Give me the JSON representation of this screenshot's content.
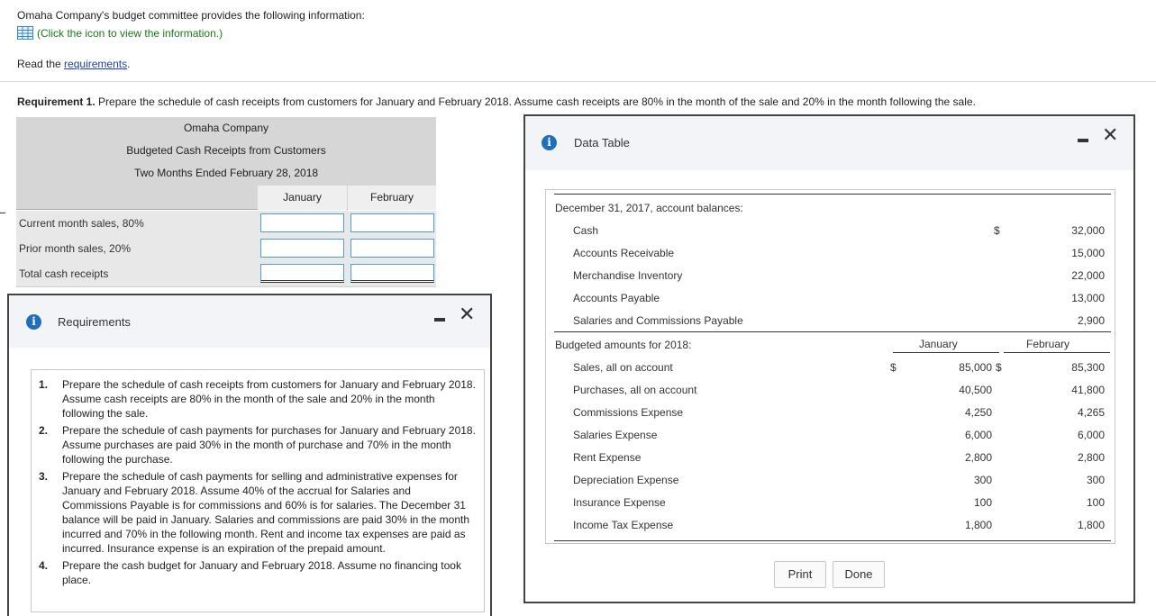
{
  "intro": {
    "line1": "Omaha Company's budget committee provides the following information:",
    "click_text": "(Click the icon to view the information.)",
    "read_prefix": "Read the ",
    "read_link": "requirements",
    "read_suffix": "."
  },
  "requirement1": {
    "label": "Requirement 1.",
    "text": " Prepare the schedule of cash receipts from customers for January and February 2018. Assume cash receipts are 80% in the month of the sale and 20% in the month following the sale."
  },
  "schedule": {
    "company": "Omaha Company",
    "title": "Budgeted Cash Receipts from Customers",
    "period": "Two Months Ended February 28, 2018",
    "columns": [
      "January",
      "February"
    ],
    "rows": [
      "Current month sales, 80%",
      "Prior month sales, 20%",
      "Total cash receipts"
    ]
  },
  "requirements_dialog": {
    "title": "Requirements",
    "items": [
      {
        "num": "1.",
        "text": "Prepare the schedule of cash receipts from customers for January and February 2018. Assume cash receipts are 80% in the month of the sale and 20% in the month following the sale."
      },
      {
        "num": "2.",
        "text": "Prepare the schedule of cash payments for purchases for January and February 2018. Assume purchases are paid 30% in the month of purchase and 70% in the month following the purchase."
      },
      {
        "num": "3.",
        "text": "Prepare the schedule of cash payments for selling and administrative expenses for January and February 2018. Assume 40% of the accrual for Salaries and Commissions Payable is for commissions and 60% is for salaries. The December 31 balance will be paid in January. Salaries and commissions are paid 30% in the month incurred and 70% in the following month. Rent and income tax expenses are paid as incurred. Insurance expense is an expiration of the prepaid amount."
      },
      {
        "num": "4.",
        "text": "Prepare the cash budget for January and February 2018. Assume no financing took place."
      }
    ]
  },
  "data_dialog": {
    "title": "Data Table",
    "balances_heading": "December 31, 2017, account balances:",
    "balances": [
      {
        "label": "Cash",
        "currency": "$",
        "value": "32,000"
      },
      {
        "label": "Accounts Receivable",
        "currency": "",
        "value": "15,000"
      },
      {
        "label": "Merchandise Inventory",
        "currency": "",
        "value": "22,000"
      },
      {
        "label": "Accounts Payable",
        "currency": "",
        "value": "13,000"
      },
      {
        "label": "Salaries and Commissions Payable",
        "currency": "",
        "value": "2,900"
      }
    ],
    "budget_heading": "Budgeted amounts for 2018:",
    "budget_columns": [
      "January",
      "February"
    ],
    "budget": [
      {
        "label": "Sales, all on account",
        "cur1": "$",
        "jan": "85,000",
        "cur2": "$",
        "feb": "85,300"
      },
      {
        "label": "Purchases, all on account",
        "cur1": "",
        "jan": "40,500",
        "cur2": "",
        "feb": "41,800"
      },
      {
        "label": "Commissions Expense",
        "cur1": "",
        "jan": "4,250",
        "cur2": "",
        "feb": "4,265"
      },
      {
        "label": "Salaries Expense",
        "cur1": "",
        "jan": "6,000",
        "cur2": "",
        "feb": "6,000"
      },
      {
        "label": "Rent Expense",
        "cur1": "",
        "jan": "2,800",
        "cur2": "",
        "feb": "2,800"
      },
      {
        "label": "Depreciation Expense",
        "cur1": "",
        "jan": "300",
        "cur2": "",
        "feb": "300"
      },
      {
        "label": "Insurance Expense",
        "cur1": "",
        "jan": "100",
        "cur2": "",
        "feb": "100"
      },
      {
        "label": "Income Tax Expense",
        "cur1": "",
        "jan": "1,800",
        "cur2": "",
        "feb": "1,800"
      }
    ],
    "print_label": "Print",
    "done_label": "Done"
  },
  "colors": {
    "link_blue": "#1a3fb5",
    "green_text": "#1a7a1a",
    "info_blue": "#1f6fb8",
    "cell_border": "#4d9ed8"
  }
}
